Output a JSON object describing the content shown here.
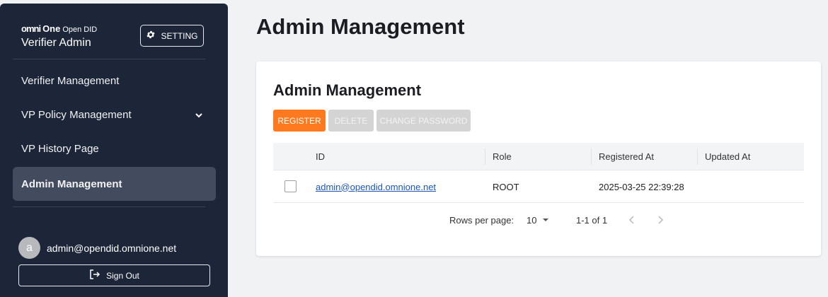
{
  "sidebar": {
    "logo": {
      "mark": "omni",
      "one": "One",
      "open": "Open",
      "did": "DID"
    },
    "app_name": "Verifier Admin",
    "setting_label": "SETTING",
    "items": [
      {
        "label": "Verifier Management"
      },
      {
        "label": "VP Policy Management"
      },
      {
        "label": "VP History Page"
      },
      {
        "label": "Admin Management"
      }
    ],
    "user": {
      "avatar_letter": "a",
      "email": "admin@opendid.omnione.net"
    },
    "sign_out_label": "Sign Out"
  },
  "main": {
    "page_title": "Admin Management",
    "card": {
      "title": "Admin Management",
      "buttons": {
        "register": "REGISTER",
        "delete": "DELETE",
        "change_password": "CHANGE PASSWORD"
      },
      "table": {
        "columns": [
          "ID",
          "Role",
          "Registered At",
          "Updated At"
        ],
        "rows": [
          {
            "id": "admin@opendid.omnione.net",
            "role": "ROOT",
            "registered_at": "2025-03-25 22:39:28",
            "updated_at": ""
          }
        ]
      },
      "pagination": {
        "rows_per_page_label": "Rows per page:",
        "rows_per_page": "10",
        "range": "1-1 of 1"
      }
    }
  },
  "colors": {
    "sidebar_bg": "#1d2639",
    "accent": "#ff7a1f",
    "link": "#1d55b8"
  }
}
